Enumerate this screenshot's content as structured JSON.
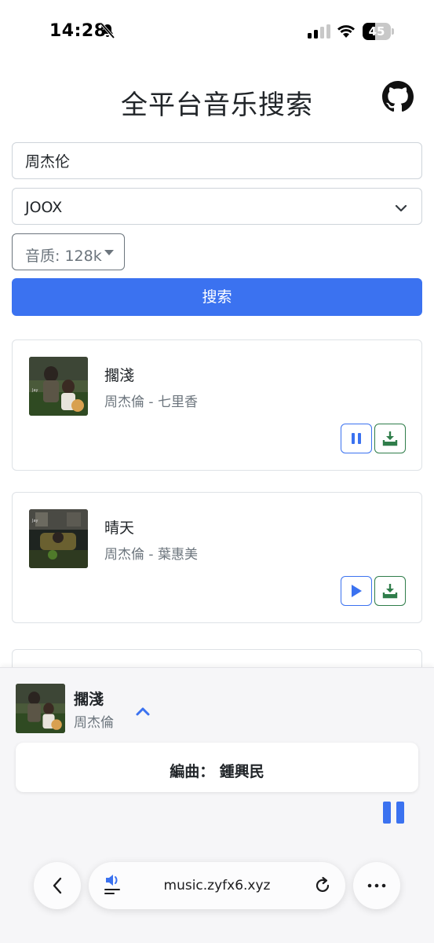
{
  "status_bar": {
    "time": "14:28",
    "battery": "45",
    "battery_level": 0.45
  },
  "header": {
    "title": "全平台音乐搜索"
  },
  "search": {
    "query": "周杰伦",
    "platform": "JOOX",
    "quality_label": "音质: 128k",
    "search_label": "搜索"
  },
  "results": [
    {
      "title": "擱淺",
      "meta": "周杰倫 - 七里香",
      "state": "playing"
    },
    {
      "title": "晴天",
      "meta": "周杰倫 - 葉惠美",
      "state": "paused"
    }
  ],
  "player": {
    "title": "擱淺",
    "artist": "周杰倫",
    "lyric": "編曲：  鍾興民"
  },
  "browser": {
    "url": "music.zyfx6.xyz"
  },
  "colors": {
    "primary": "#3b72f0",
    "success": "#2f7d4a",
    "border": "#dee2e6",
    "muted": "#6c757d"
  }
}
